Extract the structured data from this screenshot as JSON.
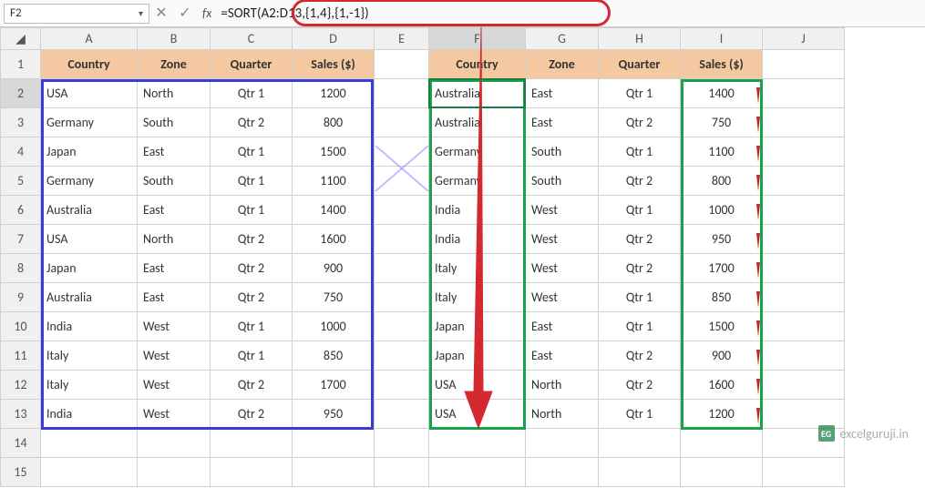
{
  "namebox": {
    "value": "F2"
  },
  "fx_label": "fx",
  "formula": "=SORT(A2:D13,{1,4},{1,-1})",
  "columns": [
    "A",
    "B",
    "C",
    "D",
    "E",
    "F",
    "G",
    "H",
    "I",
    "J"
  ],
  "row_numbers": [
    "1",
    "2",
    "3",
    "4",
    "5",
    "6",
    "7",
    "8",
    "9",
    "10",
    "11",
    "12",
    "13",
    "14",
    "15"
  ],
  "headers": {
    "country": "Country",
    "zone": "Zone",
    "quarter": "Quarter",
    "sales": "Sales ($)"
  },
  "left_table": [
    {
      "country": "USA",
      "zone": "North",
      "quarter": "Qtr 1",
      "sales": "1200"
    },
    {
      "country": "Germany",
      "zone": "South",
      "quarter": "Qtr 2",
      "sales": "800"
    },
    {
      "country": "Japan",
      "zone": "East",
      "quarter": "Qtr 1",
      "sales": "1500"
    },
    {
      "country": "Germany",
      "zone": "South",
      "quarter": "Qtr 1",
      "sales": "1100"
    },
    {
      "country": "Australia",
      "zone": "East",
      "quarter": "Qtr 1",
      "sales": "1400"
    },
    {
      "country": "USA",
      "zone": "North",
      "quarter": "Qtr 2",
      "sales": "1600"
    },
    {
      "country": "Japan",
      "zone": "East",
      "quarter": "Qtr 2",
      "sales": "900"
    },
    {
      "country": "Australia",
      "zone": "East",
      "quarter": "Qtr 2",
      "sales": "750"
    },
    {
      "country": "India",
      "zone": "West",
      "quarter": "Qtr 1",
      "sales": "1000"
    },
    {
      "country": "Italy",
      "zone": "West",
      "quarter": "Qtr 1",
      "sales": "850"
    },
    {
      "country": "Italy",
      "zone": "West",
      "quarter": "Qtr 2",
      "sales": "1700"
    },
    {
      "country": "India",
      "zone": "West",
      "quarter": "Qtr 2",
      "sales": "950"
    }
  ],
  "right_table": [
    {
      "country": "Australia",
      "zone": "East",
      "quarter": "Qtr 1",
      "sales": "1400"
    },
    {
      "country": "Australia",
      "zone": "East",
      "quarter": "Qtr 2",
      "sales": "750"
    },
    {
      "country": "Germany",
      "zone": "South",
      "quarter": "Qtr 1",
      "sales": "1100"
    },
    {
      "country": "Germany",
      "zone": "South",
      "quarter": "Qtr 2",
      "sales": "800"
    },
    {
      "country": "India",
      "zone": "West",
      "quarter": "Qtr 1",
      "sales": "1000"
    },
    {
      "country": "India",
      "zone": "West",
      "quarter": "Qtr 2",
      "sales": "950"
    },
    {
      "country": "Italy",
      "zone": "West",
      "quarter": "Qtr 2",
      "sales": "1700"
    },
    {
      "country": "Italy",
      "zone": "West",
      "quarter": "Qtr 1",
      "sales": "850"
    },
    {
      "country": "Japan",
      "zone": "East",
      "quarter": "Qtr 1",
      "sales": "1500"
    },
    {
      "country": "Japan",
      "zone": "East",
      "quarter": "Qtr 2",
      "sales": "900"
    },
    {
      "country": "USA",
      "zone": "North",
      "quarter": "Qtr 2",
      "sales": "1600"
    },
    {
      "country": "USA",
      "zone": "North",
      "quarter": "Qtr 1",
      "sales": "1200"
    }
  ],
  "watermark": "excelguruji.in",
  "watermark_logo": "EG"
}
